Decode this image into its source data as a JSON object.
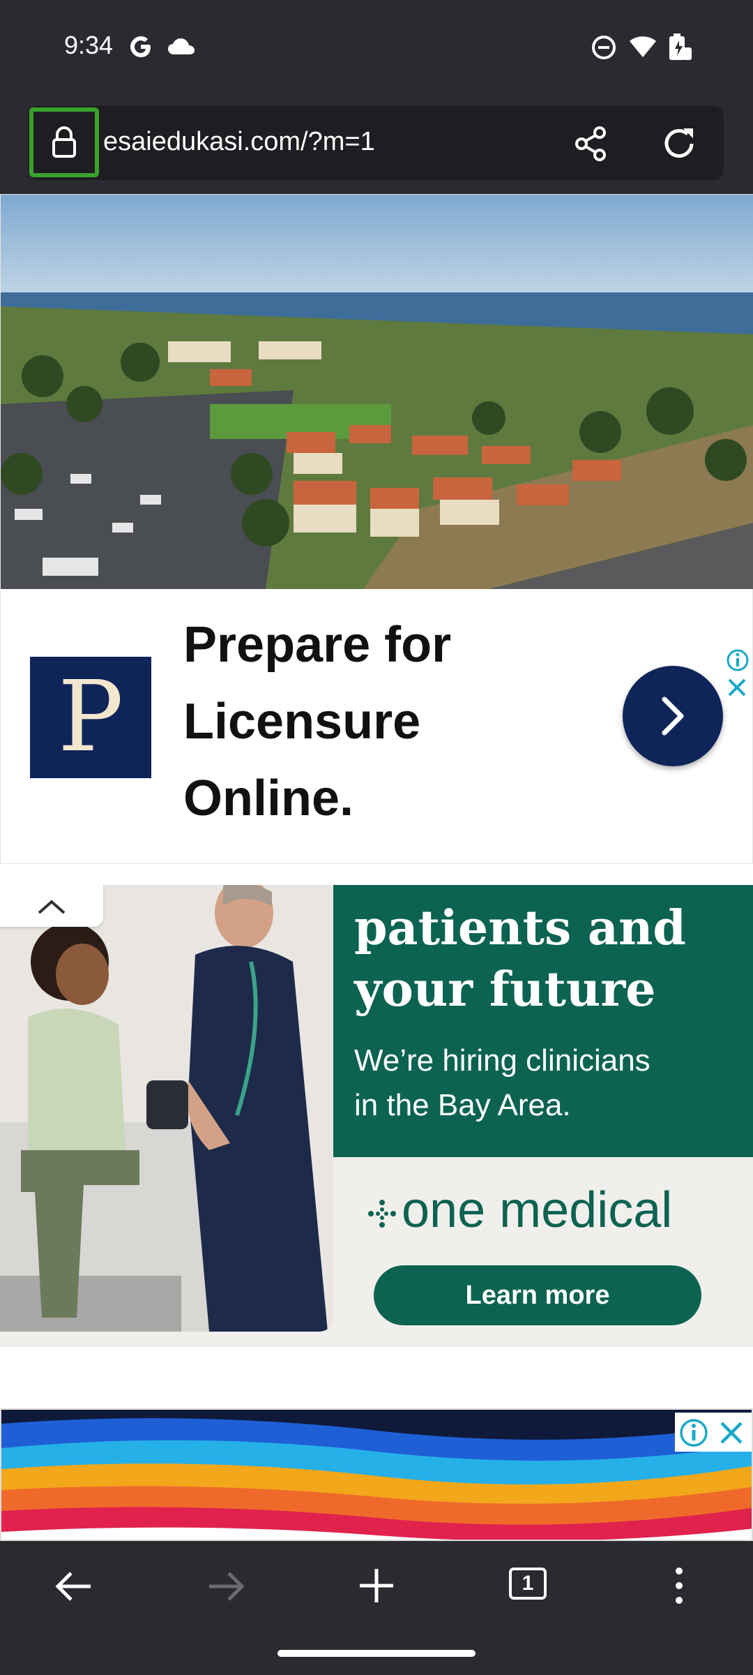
{
  "status_bar": {
    "time": "9:34",
    "icons": [
      "google-icon",
      "cloud-icon",
      "do-not-disturb-icon",
      "wifi-icon",
      "battery-charging-icon"
    ]
  },
  "address_bar": {
    "url": "esaiedukasi.com/?m=1",
    "icons": [
      "lock-icon",
      "share-icon",
      "reload-icon"
    ]
  },
  "ad_1": {
    "logo_letter": "P",
    "headline_lines": [
      "Prepare for",
      "Licensure",
      "Online."
    ],
    "icons": [
      "chevron-right-icon",
      "ad-info-icon",
      "ad-close-icon"
    ],
    "colors": {
      "navy": "#0f2559",
      "info_cyan": "#19a9c7"
    }
  },
  "ad_2": {
    "headline_partial": "patients and your future",
    "headline_lines": [
      "patients and",
      "your future"
    ],
    "subtext_lines": [
      "We’re hiring clinicians",
      "in the Bay Area."
    ],
    "brand": "one medical",
    "button": "Learn more",
    "colors": {
      "green": "#0c6351",
      "cream": "#f1efec"
    }
  },
  "ad_3": {
    "icons": [
      "ad-info-icon",
      "ad-close-icon"
    ]
  },
  "bottom_nav": {
    "tab_count": "1",
    "icons": [
      "back-arrow-icon",
      "forward-arrow-icon",
      "new-tab-plus-icon",
      "tab-switcher-icon",
      "more-menu-icon"
    ]
  }
}
